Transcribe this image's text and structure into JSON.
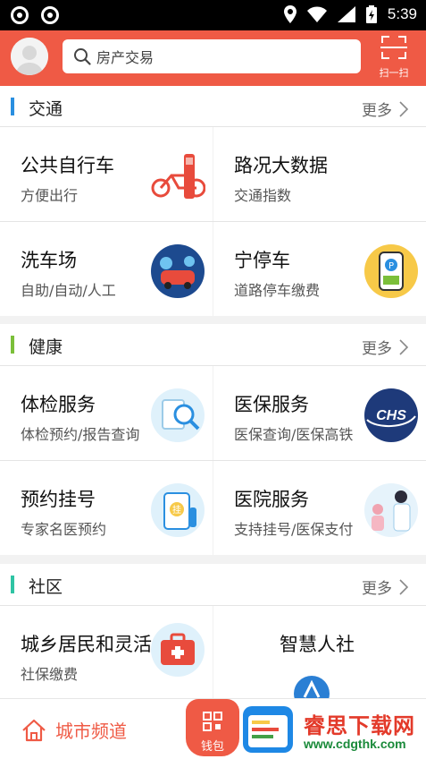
{
  "status_bar": {
    "time": "5:39"
  },
  "header": {
    "search_placeholder": "房产交易",
    "scan_label": "扫一扫",
    "accent": "#ef5a45"
  },
  "sections": [
    {
      "title": "交通",
      "more": "更多",
      "bar_color": "#2a8fe0",
      "cards": [
        {
          "title": "公共自行车",
          "sub": "方便出行",
          "icon": "bicycle-icon"
        },
        {
          "title": "路况大数据",
          "sub": "交通指数",
          "icon": ""
        },
        {
          "title": "洗车场",
          "sub": "自助/自动/人工",
          "icon": "car-wash-icon"
        },
        {
          "title": "宁停车",
          "sub": "道路停车缴费",
          "icon": "parking-meter-icon"
        }
      ]
    },
    {
      "title": "健康",
      "more": "更多",
      "bar_color": "#7bbf3a",
      "cards": [
        {
          "title": "体检服务",
          "sub": "体检预约/报告查询",
          "icon": "medical-checkup-icon"
        },
        {
          "title": "医保服务",
          "sub": "医保查询/医保高铁",
          "icon": "chs-logo-icon",
          "logo_text": "CHS"
        },
        {
          "title": "预约挂号",
          "sub": "专家名医预约",
          "icon": "appointment-icon",
          "badge_text": "挂"
        },
        {
          "title": "医院服务",
          "sub": "支持挂号/医保支付",
          "icon": "hospital-doctor-icon"
        }
      ]
    },
    {
      "title": "社区",
      "more": "更多",
      "bar_color": "#2fc4a4",
      "cards": [
        {
          "title": "城乡居民和灵活",
          "sub": "社保缴费",
          "icon": "first-aid-kit-icon"
        },
        {
          "title": "智慧人社",
          "sub": "",
          "icon": "smart-hr-icon"
        }
      ]
    }
  ],
  "bottom_bar": {
    "city_label": "城市频道",
    "wallet_label": "钱包"
  },
  "watermark": {
    "title": "睿思下载网",
    "url": "www.cdgthk.com"
  }
}
